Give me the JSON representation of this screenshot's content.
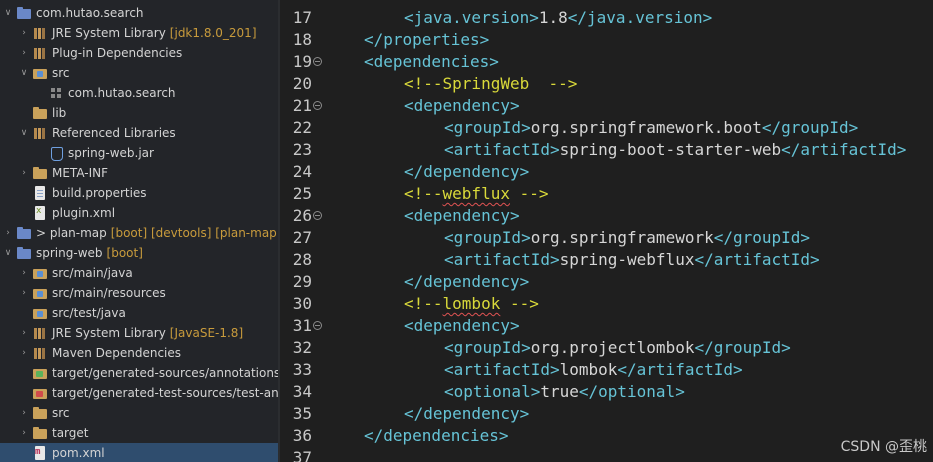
{
  "explorer": {
    "items": [
      {
        "label": "com.hutao.search",
        "decoration": "",
        "icon": "plugin-project-icon",
        "indent": 0,
        "expanded": true
      },
      {
        "label": "JRE System Library",
        "decoration": "[jdk1.8.0_201]",
        "icon": "library-icon",
        "indent": 1,
        "expanded": false
      },
      {
        "label": "Plug-in Dependencies",
        "decoration": "",
        "icon": "library-icon",
        "indent": 1,
        "expanded": false
      },
      {
        "label": "src",
        "decoration": "",
        "icon": "source-folder-icon",
        "indent": 1,
        "expanded": true
      },
      {
        "label": "com.hutao.search",
        "decoration": "",
        "icon": "package-icon",
        "indent": 2,
        "expanded": null
      },
      {
        "label": "lib",
        "decoration": "",
        "icon": "folder-icon",
        "indent": 1,
        "expanded": null
      },
      {
        "label": "Referenced Libraries",
        "decoration": "",
        "icon": "library-icon",
        "indent": 1,
        "expanded": true
      },
      {
        "label": "spring-web.jar",
        "decoration": "",
        "icon": "jar-icon",
        "indent": 2,
        "expanded": null
      },
      {
        "label": "META-INF",
        "decoration": "",
        "icon": "folder-icon",
        "indent": 1,
        "expanded": false
      },
      {
        "label": "build.properties",
        "decoration": "",
        "icon": "file-icon",
        "indent": 1,
        "expanded": null
      },
      {
        "label": "plugin.xml",
        "decoration": "",
        "icon": "xml-file-icon",
        "indent": 1,
        "expanded": null
      },
      {
        "label": "> plan-map",
        "decoration": "[boot] [devtools] [plan-map r",
        "icon": "plugin-project-icon",
        "indent": 0,
        "expanded": false
      },
      {
        "label": "spring-web",
        "decoration": "[boot]",
        "icon": "plugin-project-icon",
        "indent": 0,
        "expanded": true
      },
      {
        "label": "src/main/java",
        "decoration": "",
        "icon": "source-folder-icon",
        "indent": 1,
        "expanded": false
      },
      {
        "label": "src/main/resources",
        "decoration": "",
        "icon": "source-folder-icon",
        "indent": 1,
        "expanded": false
      },
      {
        "label": "src/test/java",
        "decoration": "",
        "icon": "source-folder-icon",
        "indent": 1,
        "expanded": null
      },
      {
        "label": "JRE System Library",
        "decoration": "[JavaSE-1.8]",
        "icon": "library-icon",
        "indent": 1,
        "expanded": false
      },
      {
        "label": "Maven Dependencies",
        "decoration": "",
        "icon": "library-icon",
        "indent": 1,
        "expanded": false
      },
      {
        "label": "target/generated-sources/annotations",
        "decoration": "",
        "icon": "generated-folder-icon",
        "indent": 1,
        "expanded": null
      },
      {
        "label": "target/generated-test-sources/test-ann",
        "decoration": "",
        "icon": "generated-test-folder-icon",
        "indent": 1,
        "expanded": null
      },
      {
        "label": "src",
        "decoration": "",
        "icon": "folder-icon",
        "indent": 1,
        "expanded": false
      },
      {
        "label": "target",
        "decoration": "",
        "icon": "folder-icon",
        "indent": 1,
        "expanded": false
      },
      {
        "label": "pom.xml",
        "decoration": "",
        "icon": "pom-file-icon",
        "indent": 1,
        "expanded": null,
        "selected": true
      }
    ]
  },
  "editor": {
    "lines": [
      {
        "num": "17",
        "fold": false,
        "indent": 1,
        "parts": [
          [
            "tag",
            "<java.version>"
          ],
          [
            "txt",
            "1.8"
          ],
          [
            "tag",
            "</java.version>"
          ]
        ]
      },
      {
        "num": "18",
        "fold": false,
        "indent": 0,
        "parts": [
          [
            "tag",
            "</properties>"
          ]
        ]
      },
      {
        "num": "19",
        "fold": true,
        "indent": 0,
        "parts": [
          [
            "tag",
            "<dependencies>"
          ]
        ]
      },
      {
        "num": "20",
        "fold": false,
        "indent": 1,
        "parts": [
          [
            "cmt",
            "<!--SpringWeb  -->"
          ]
        ]
      },
      {
        "num": "21",
        "fold": true,
        "indent": 1,
        "parts": [
          [
            "tag",
            "<dependency>"
          ]
        ]
      },
      {
        "num": "22",
        "fold": false,
        "indent": 2,
        "parts": [
          [
            "tag",
            "<groupId>"
          ],
          [
            "txt",
            "org.springframework.boot"
          ],
          [
            "tag",
            "</groupId>"
          ]
        ]
      },
      {
        "num": "23",
        "fold": false,
        "indent": 2,
        "parts": [
          [
            "tag",
            "<artifactId>"
          ],
          [
            "txt",
            "spring-boot-starter-web"
          ],
          [
            "tag",
            "</artifactId>"
          ]
        ]
      },
      {
        "num": "24",
        "fold": false,
        "indent": 1,
        "parts": [
          [
            "tag",
            "</dependency>"
          ]
        ]
      },
      {
        "num": "25",
        "fold": false,
        "indent": 1,
        "parts": [
          [
            "cmt",
            "<!--"
          ],
          [
            "cmt-squig",
            "webflux"
          ],
          [
            "cmt",
            " -->"
          ]
        ]
      },
      {
        "num": "26",
        "fold": true,
        "indent": 1,
        "parts": [
          [
            "tag",
            "<dependency>"
          ]
        ]
      },
      {
        "num": "27",
        "fold": false,
        "indent": 2,
        "parts": [
          [
            "tag",
            "<groupId>"
          ],
          [
            "txt",
            "org.springframework"
          ],
          [
            "tag",
            "</groupId>"
          ]
        ]
      },
      {
        "num": "28",
        "fold": false,
        "indent": 2,
        "parts": [
          [
            "tag",
            "<artifactId>"
          ],
          [
            "txt",
            "spring-webflux"
          ],
          [
            "tag",
            "</artifactId>"
          ]
        ]
      },
      {
        "num": "29",
        "fold": false,
        "indent": 1,
        "parts": [
          [
            "tag",
            "</dependency>"
          ]
        ]
      },
      {
        "num": "30",
        "fold": false,
        "indent": 1,
        "parts": [
          [
            "cmt",
            "<!--"
          ],
          [
            "cmt-squig",
            "lombok"
          ],
          [
            "cmt",
            " -->"
          ]
        ]
      },
      {
        "num": "31",
        "fold": true,
        "indent": 1,
        "parts": [
          [
            "tag",
            "<dependency>"
          ]
        ]
      },
      {
        "num": "32",
        "fold": false,
        "indent": 2,
        "parts": [
          [
            "tag",
            "<groupId>"
          ],
          [
            "txt",
            "org.projectlombok"
          ],
          [
            "tag",
            "</groupId>"
          ]
        ]
      },
      {
        "num": "33",
        "fold": false,
        "indent": 2,
        "parts": [
          [
            "tag",
            "<artifactId>"
          ],
          [
            "txt",
            "lombok"
          ],
          [
            "tag",
            "</artifactId>"
          ]
        ]
      },
      {
        "num": "34",
        "fold": false,
        "indent": 2,
        "parts": [
          [
            "tag",
            "<optional>"
          ],
          [
            "txt",
            "true"
          ],
          [
            "tag",
            "</optional>"
          ]
        ]
      },
      {
        "num": "35",
        "fold": false,
        "indent": 1,
        "parts": [
          [
            "tag",
            "</dependency>"
          ]
        ]
      },
      {
        "num": "36",
        "fold": false,
        "indent": 0,
        "parts": [
          [
            "tag",
            "</dependencies>"
          ]
        ]
      },
      {
        "num": "37",
        "fold": false,
        "indent": 0,
        "parts": []
      }
    ]
  },
  "watermark": "CSDN @歪桃"
}
